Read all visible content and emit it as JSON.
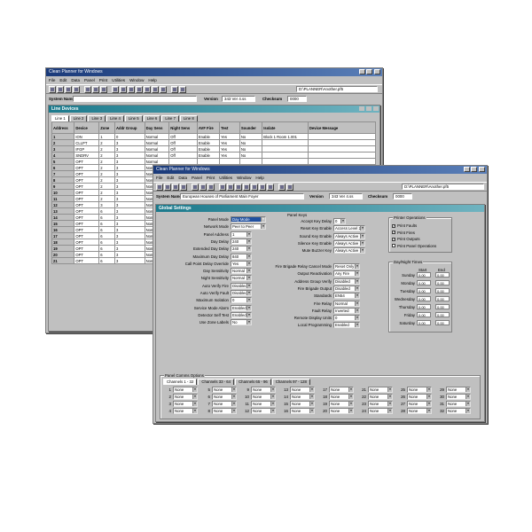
{
  "back_window": {
    "title": "Clean Planner for Windows",
    "menu": [
      "File",
      "Edit",
      "Data",
      "Panel",
      "Print",
      "Utilities",
      "Window",
      "Help"
    ],
    "path": "D:\\PLANNER\\Another.pf5",
    "system_name_label": "System Name",
    "version_label": "Version",
    "version_value": "343 Ver 4.ss",
    "checksum_label": "Checksum",
    "checksum_value": "0000",
    "line_devices": {
      "title": "Line Devices",
      "tabs": [
        "Line 1",
        "Line 2",
        "Line 3",
        "Line 4",
        "Line 5",
        "Line 6",
        "Line 7",
        "Line 8"
      ],
      "columns": [
        "Address",
        "Device",
        "Zone",
        "Addr Group",
        "Day Sens",
        "Night Sens",
        "AVF Fire",
        "Test",
        "Sounder",
        "Isolate",
        "Device Message"
      ],
      "rows": [
        [
          "1",
          "ION",
          "1",
          "0",
          "Normal",
          "Off",
          "Enable",
          "Yes",
          "No",
          "Block 1 Room 1.001"
        ],
        [
          "2",
          "CLLPT",
          "2",
          "3",
          "Normal",
          "Off",
          "Enable",
          "Yes",
          "No",
          ""
        ],
        [
          "3",
          "IFGP",
          "2",
          "3",
          "Normal",
          "Off",
          "Enable",
          "Yes",
          "No",
          ""
        ],
        [
          "4",
          "SNDRV",
          "2",
          "3",
          "Normal",
          "Off",
          "Enable",
          "Yes",
          "No",
          ""
        ],
        [
          "5",
          "OPT",
          "2",
          "3",
          "Normal",
          "",
          "",
          "",
          "",
          ""
        ],
        [
          "6",
          "OPT",
          "2",
          "3",
          "Normal",
          "",
          "",
          "",
          "",
          ""
        ],
        [
          "7",
          "OPT",
          "2",
          "3",
          "Normal",
          "",
          "",
          "",
          "",
          ""
        ],
        [
          "8",
          "OPT",
          "2",
          "3",
          "Normal",
          "",
          "",
          "",
          "",
          ""
        ],
        [
          "9",
          "OPT",
          "2",
          "3",
          "Normal",
          "",
          "",
          "",
          "",
          ""
        ],
        [
          "10",
          "OPT",
          "2",
          "3",
          "Normal",
          "",
          "",
          "",
          "",
          ""
        ],
        [
          "11",
          "OPT",
          "2",
          "3",
          "Normal",
          "",
          "",
          "",
          "",
          ""
        ],
        [
          "12",
          "OPT",
          "3",
          "3",
          "Normal",
          "",
          "",
          "",
          "",
          ""
        ],
        [
          "13",
          "OPT",
          "6",
          "3",
          "Normal",
          "",
          "",
          "",
          "",
          ""
        ],
        [
          "14",
          "OPT",
          "6",
          "3",
          "Normal",
          "",
          "",
          "",
          "",
          ""
        ],
        [
          "15",
          "OPT",
          "6",
          "3",
          "Normal",
          "",
          "",
          "",
          "",
          ""
        ],
        [
          "16",
          "OPT",
          "6",
          "3",
          "Normal",
          "",
          "",
          "",
          "",
          ""
        ],
        [
          "17",
          "OPT",
          "6",
          "3",
          "Normal",
          "",
          "",
          "",
          "",
          ""
        ],
        [
          "18",
          "OPT",
          "6",
          "3",
          "Normal",
          "",
          "",
          "",
          "",
          ""
        ],
        [
          "19",
          "OPT",
          "6",
          "3",
          "Normal",
          "",
          "",
          "",
          "",
          ""
        ],
        [
          "20",
          "OPT",
          "6",
          "3",
          "Normal",
          "",
          "",
          "",
          "",
          ""
        ],
        [
          "21",
          "OPT",
          "6",
          "3",
          "Normal",
          "",
          "",
          "",
          "",
          ""
        ]
      ]
    }
  },
  "front_window": {
    "title": "Clean Planner for Windows",
    "menu": [
      "File",
      "Edit",
      "Data",
      "Panel",
      "Print",
      "Utilities",
      "Window",
      "Help"
    ],
    "path": "D:\\PLANNER\\Another.pf5",
    "system_name_label": "System Name",
    "system_name_value": "European Houses of Parliament Main Foyer",
    "version_label": "Version",
    "version_value": "343 Ver 4.ss",
    "checksum_label": "Checksum",
    "checksum_value": "0000",
    "global_settings": {
      "title": "Global Settings",
      "left_fields": [
        {
          "label": "Panel Mode",
          "value": "Day Mode",
          "selected": true
        },
        {
          "label": "Network Mode",
          "value": "Peer to Peer"
        },
        {
          "label": "Panel Address",
          "value": "1"
        },
        {
          "label": "Day Delay",
          "value": "240"
        },
        {
          "label": "Extended Day Delay",
          "value": "240"
        },
        {
          "label": "Maximum Day Delay",
          "value": "840"
        },
        {
          "label": "Call Point Delay Override",
          "value": "Yes"
        },
        {
          "label": "Day Sensitivity",
          "value": "Normal"
        },
        {
          "label": "Night Sensitivity",
          "value": "Normal"
        },
        {
          "label": "Auto Verify Fire",
          "value": "Disabled"
        },
        {
          "label": "Auto Verify Fault",
          "value": "Disabled"
        },
        {
          "label": "Maximum Isolation",
          "value": "0"
        },
        {
          "label": "Service Mode Alarm",
          "value": "Enabled"
        },
        {
          "label": "Detector Self Test",
          "value": "Enabled"
        },
        {
          "label": "Use Zone Labels",
          "value": "No"
        }
      ],
      "panel_keys_title": "Panel Keys",
      "key_fields": [
        {
          "label": "Accept Key Delay",
          "value": "0"
        },
        {
          "label": "Reset Key Enable",
          "value": "Access Level 2"
        },
        {
          "label": "Sound Key Enable",
          "value": "Always Active"
        },
        {
          "label": "Silence Key Enable",
          "value": "Always Active"
        },
        {
          "label": "Mute Buzzer Key",
          "value": "Always Active"
        }
      ],
      "mid_fields": [
        {
          "label": "Fire Brigade Relay Cancel Mode",
          "value": "Reset Only"
        },
        {
          "label": "Output Reactivation",
          "value": "Any Fire"
        },
        {
          "label": "Address Group Verify",
          "value": "Disabled"
        },
        {
          "label": "Fire Brigade Output",
          "value": "Disabled"
        },
        {
          "label": "Standards",
          "value": "EN54"
        },
        {
          "label": "Fire Relay",
          "value": "Normal"
        },
        {
          "label": "Fault Relay",
          "value": "Inverted"
        },
        {
          "label": "Remote Display Units",
          "value": "0"
        },
        {
          "label": "Local Programming",
          "value": "Enabled"
        }
      ],
      "printer": {
        "title": "Printer Operations",
        "options": [
          {
            "label": "Print Faults",
            "checked": true
          },
          {
            "label": "Print Fires",
            "checked": true
          },
          {
            "label": "Print Outputs",
            "checked": true
          },
          {
            "label": "Print Panel Operations",
            "checked": false
          }
        ]
      },
      "day_night": {
        "title": "Day/Night Times",
        "start_label": "Start",
        "end_label": "End",
        "days": [
          {
            "day": "Sunday",
            "start": "0.00",
            "end": "0.00"
          },
          {
            "day": "Monday",
            "start": "0.00",
            "end": "0.00"
          },
          {
            "day": "Tuesday",
            "start": "0.00",
            "end": "0.00"
          },
          {
            "day": "Wednesday",
            "start": "0.00",
            "end": "0.00"
          },
          {
            "day": "Thursday",
            "start": "0.00",
            "end": "0.00"
          },
          {
            "day": "Friday",
            "start": "0.00",
            "end": "0.00"
          },
          {
            "day": "Saturday",
            "start": "0.00",
            "end": "0.00"
          }
        ]
      },
      "comms": {
        "title": "Panel Comms Options",
        "tabs": [
          "Channels 1 - 32",
          "Channels 33 - 64",
          "Channels 65 - 96",
          "Channels 97 - 128"
        ],
        "channel_value": "None",
        "channels": [
          "1",
          "2",
          "3",
          "4",
          "5",
          "6",
          "7",
          "8",
          "9",
          "10",
          "11",
          "12",
          "13",
          "14",
          "15",
          "16",
          "17",
          "18",
          "19",
          "20",
          "21",
          "22",
          "23",
          "24",
          "25",
          "26",
          "27",
          "28",
          "29",
          "30",
          "31",
          "32"
        ]
      }
    }
  }
}
